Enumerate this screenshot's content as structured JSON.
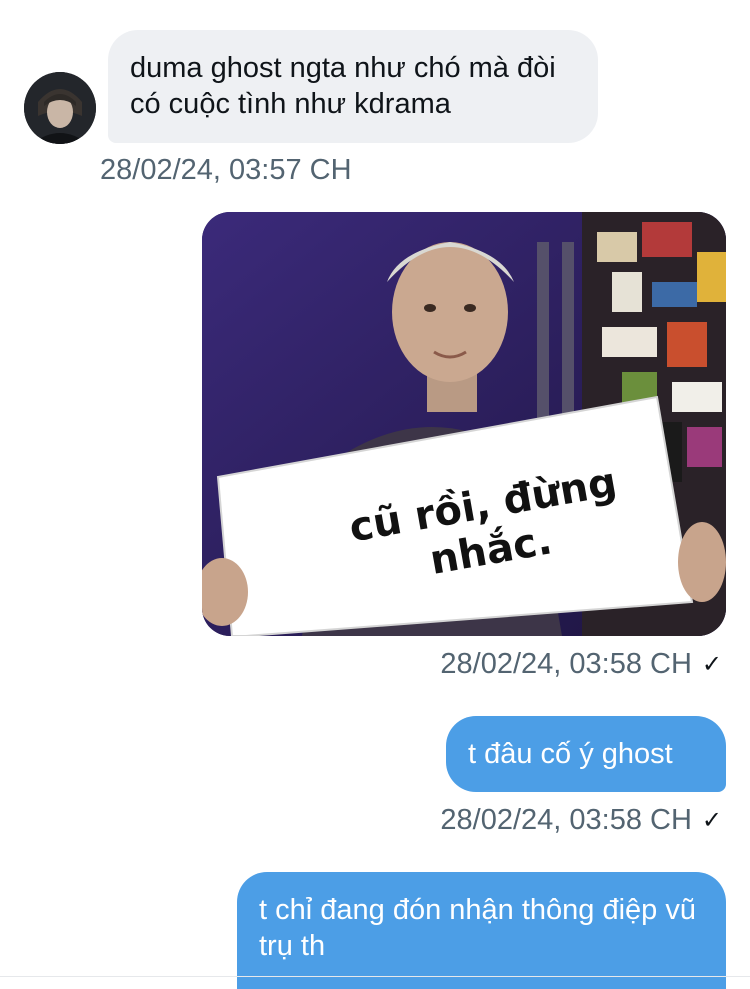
{
  "messages": [
    {
      "direction": "incoming",
      "text": "duma ghost ngta như chó mà đòi có cuộc tình như kdrama",
      "timestamp": "28/02/24, 03:57 CH"
    },
    {
      "direction": "outgoing",
      "type": "image",
      "image_caption": "cũ rồi, đừng nhắc.",
      "timestamp": "28/02/24, 03:58 CH",
      "status": "✓"
    },
    {
      "direction": "outgoing",
      "text": "t đâu cố ý ghost",
      "timestamp": "28/02/24, 03:58 CH",
      "status": "✓"
    },
    {
      "direction": "outgoing",
      "text": "t chỉ đang đón nhận thông điệp vũ trụ th"
    }
  ],
  "colors": {
    "incoming_bubble": "#eef0f3",
    "outgoing_bubble": "#4c9ee6",
    "timestamp": "#536471"
  },
  "icons": [
    "avatar",
    "read-checkmark-icon"
  ]
}
